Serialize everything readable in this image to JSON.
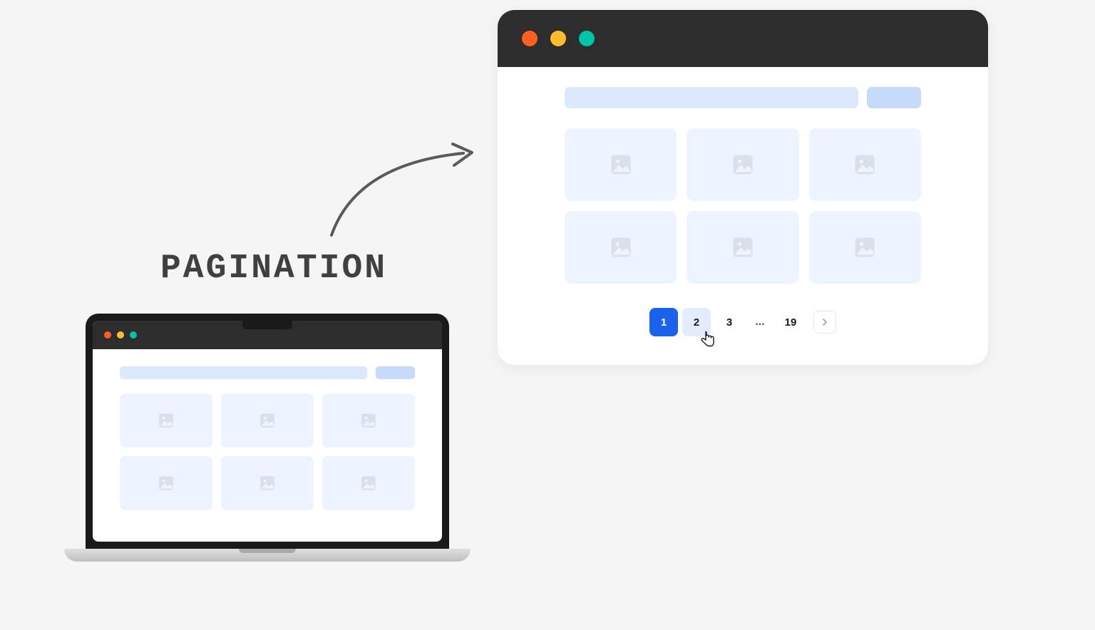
{
  "title": "PAGINATION",
  "pagination": {
    "p1": "1",
    "p2": "2",
    "p3": "3",
    "ellipsis": "...",
    "last": "19"
  },
  "colors": {
    "dot_red": "#ff5f1f",
    "dot_yellow": "#ffbd2e",
    "dot_green": "#00c4a7",
    "accent": "#1a61eb",
    "card_bg": "#eef4ff",
    "search_bg": "#dce8fb"
  }
}
